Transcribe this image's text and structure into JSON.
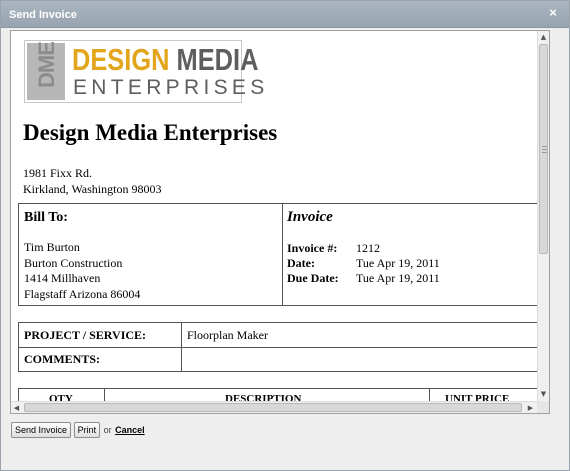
{
  "dialog": {
    "title": "Send Invoice",
    "close_glyph": "×"
  },
  "logo": {
    "mark": "DME",
    "top_gold": "DESIGN",
    "top_gray": "MEDIA",
    "bottom": "ENTERPRISES"
  },
  "company": {
    "name": "Design Media Enterprises",
    "address_line1": "1981 Fixx Rd.",
    "address_line2": "Kirkland, Washington 98003"
  },
  "bill_to": {
    "heading": "Bill To:",
    "lines": [
      "Tim Burton",
      "Burton Construction",
      "1414 Millhaven",
      "Flagstaff Arizona 86004"
    ]
  },
  "invoice": {
    "heading": "Invoice",
    "rows": [
      {
        "label": "Invoice #:",
        "value": "1212"
      },
      {
        "label": "Date:",
        "value": "Tue Apr 19, 2011"
      },
      {
        "label": "Due Date:",
        "value": "Tue Apr 19, 2011"
      }
    ]
  },
  "project": {
    "service_label": "PROJECT / SERVICE:",
    "service_value": "Floorplan Maker",
    "comments_label": "COMMENTS:",
    "comments_value": ""
  },
  "items_table": {
    "headers": [
      "QTY",
      "DESCRIPTION",
      "UNIT PRICE"
    ]
  },
  "actions": {
    "send_label": "Send Invoice",
    "print_label": "Print",
    "or_text": "or",
    "cancel_label": "Cancel"
  },
  "background": {
    "left_mark": "ll"
  },
  "colors": {
    "titlebar": "#9fabb7",
    "logo_gold": "#e3a51c",
    "logo_gray": "#5e5e5e"
  },
  "icons": {
    "close": "close-icon",
    "scroll_up": "scroll-up-arrow-icon",
    "scroll_down": "scroll-down-arrow-icon",
    "scroll_left": "scroll-left-arrow-icon",
    "scroll_right": "scroll-right-arrow-icon"
  }
}
